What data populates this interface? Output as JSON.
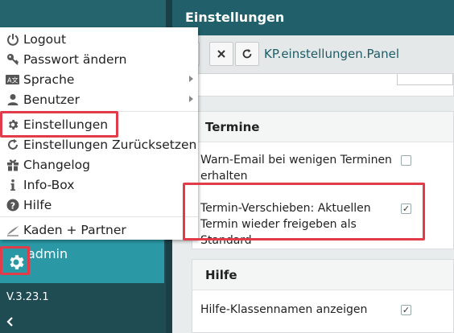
{
  "menu": {
    "items": [
      {
        "id": "logout",
        "label": "Logout",
        "icon": "power-icon",
        "submenu": false
      },
      {
        "id": "password",
        "label": "Passwort ändern",
        "icon": "key-icon",
        "submenu": false
      },
      {
        "id": "language",
        "label": "Sprache",
        "icon": "language-icon",
        "submenu": true
      },
      {
        "id": "user",
        "label": "Benutzer",
        "icon": "user-icon",
        "submenu": true
      },
      {
        "id": "settings",
        "label": "Einstellungen",
        "icon": "gear-icon",
        "submenu": false
      },
      {
        "id": "reset",
        "label": "Einstellungen Zurücksetzen",
        "icon": "reset-icon",
        "submenu": false
      },
      {
        "id": "changelog",
        "label": "Changelog",
        "icon": "gift-icon",
        "submenu": false
      },
      {
        "id": "infobox",
        "label": "Info-Box",
        "icon": "info-icon",
        "submenu": false
      },
      {
        "id": "help",
        "label": "Hilfe",
        "icon": "question-icon",
        "submenu": false
      },
      {
        "id": "partner",
        "label": "Kaden + Partner",
        "icon": "partner-logo-icon",
        "submenu": false
      }
    ]
  },
  "sidebar": {
    "username": "admin",
    "version": "V.3.23.1"
  },
  "main": {
    "title": "Einstellungen",
    "path": "KP.einstellungen.Panel",
    "sections": [
      {
        "title": "Termine",
        "rows": [
          {
            "label": "Warn-Email bei wenigen Terminen erhalten",
            "checked": false
          },
          {
            "label": "Termin-Verschieben: Aktuellen Termin wieder freigeben als Standard",
            "checked": true
          }
        ]
      },
      {
        "title": "Hilfe",
        "rows": [
          {
            "label": "Hilfe-Klassennamen anzeigen",
            "checked": true
          }
        ]
      }
    ]
  },
  "colors": {
    "sidebar": "#1f4b53",
    "title_bar": "#21606a",
    "user_box": "#2b98a6",
    "highlight": "#e23b4a"
  }
}
